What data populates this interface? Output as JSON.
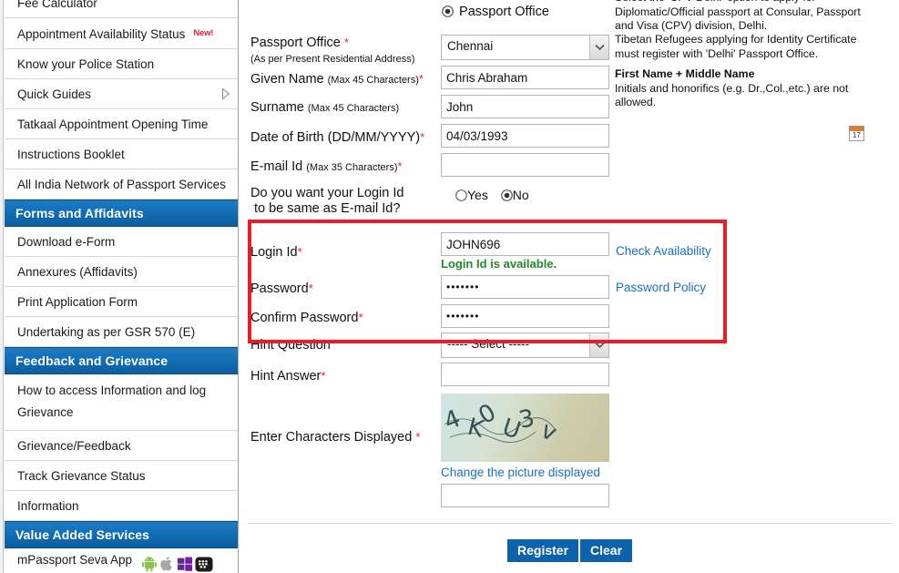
{
  "sidebar": {
    "items": [
      {
        "label": "Fee Calculator",
        "badge": null,
        "caret": false,
        "type": "item",
        "partial": true
      },
      {
        "label": "Appointment Availability Status",
        "badge": "New!",
        "caret": false,
        "type": "item"
      },
      {
        "label": "Know your Police Station",
        "badge": null,
        "caret": false,
        "type": "item"
      },
      {
        "label": "Quick Guides",
        "badge": null,
        "caret": true,
        "type": "item"
      },
      {
        "label": "Tatkaal Appointment Opening Time",
        "badge": null,
        "caret": false,
        "type": "item"
      },
      {
        "label": "Instructions Booklet",
        "badge": null,
        "caret": false,
        "type": "item"
      },
      {
        "label": "All India Network of Passport Services",
        "badge": null,
        "caret": false,
        "type": "item"
      },
      {
        "label": "Forms and Affidavits",
        "type": "header"
      },
      {
        "label": "Download e-Form",
        "badge": null,
        "caret": false,
        "type": "item"
      },
      {
        "label": "Annexures (Affidavits)",
        "badge": null,
        "caret": false,
        "type": "item"
      },
      {
        "label": "Print Application Form",
        "badge": null,
        "caret": false,
        "type": "item"
      },
      {
        "label": "Undertaking as per GSR 570 (E)",
        "badge": null,
        "caret": false,
        "type": "item"
      },
      {
        "label": "Feedback and Grievance",
        "type": "header"
      },
      {
        "label": "How to access Information and log Grievance",
        "badge": null,
        "caret": false,
        "type": "item",
        "twoline": true
      },
      {
        "label": "Grievance/Feedback",
        "badge": null,
        "caret": false,
        "type": "item"
      },
      {
        "label": "Track Grievance Status",
        "badge": null,
        "caret": false,
        "type": "item"
      },
      {
        "label": "Information",
        "badge": null,
        "caret": false,
        "type": "item"
      },
      {
        "label": "Value Added Services",
        "type": "header"
      },
      {
        "label": "mPassport Seva App",
        "type": "app-row",
        "icons": [
          "android-icon",
          "apple-icon",
          "windows-icon",
          "blackberry-icon"
        ]
      }
    ]
  },
  "form": {
    "office_radio": {
      "label": "Passport Office",
      "selected": true
    },
    "passport_office": {
      "label": "Passport Office",
      "sublabel": "(As per Present Residential Address)",
      "required": true,
      "value": "Chennai"
    },
    "given_name": {
      "label": "Given Name",
      "sublabel": "(Max 45 Characters)",
      "required": true,
      "value": "Chris Abraham"
    },
    "surname": {
      "label": "Surname",
      "sublabel": "(Max 45 Characters)",
      "required": false,
      "value": "John"
    },
    "dob": {
      "label": "Date of Birth (DD/MM/YYYY)",
      "required": true,
      "value": "04/03/1993",
      "calendar_day": "17"
    },
    "email": {
      "label": "E-mail Id",
      "sublabel": "(Max 35 Characters)",
      "required": true,
      "value": ""
    },
    "login_same_as_email": {
      "label_line1": "Do you want your Login Id",
      "label_line2": "to be same as E-mail Id?",
      "yes_label": "Yes",
      "no_label": "No",
      "selected": "No"
    },
    "login_id": {
      "label": "Login Id",
      "required": true,
      "value": "JOHN696",
      "link": "Check Availability",
      "availability_message": "Login Id is available."
    },
    "password": {
      "label": "Password",
      "required": true,
      "value": "•••••••",
      "link": "Password Policy"
    },
    "confirm_password": {
      "label": "Confirm Password",
      "required": true,
      "value": "•••••••"
    },
    "hint_question": {
      "label": "Hint Question",
      "required": false,
      "value": "----- Select -----"
    },
    "hint_answer": {
      "label": "Hint Answer",
      "required": true,
      "value": ""
    },
    "captcha": {
      "label": "Enter Characters Displayed",
      "required": true,
      "change_link": "Change the picture displayed",
      "value": ""
    },
    "buttons": {
      "register": "Register",
      "clear": "Clear"
    }
  },
  "helpers": {
    "cpv_delhi": "Select the 'CPV Delhi' option to apply for Diplomatic/Official passport at Consular, Passport and Visa (CPV) division, Delhi.",
    "tibetan": "Tibetan Refugees applying for Identity Certificate must register with 'Delhi' Passport Office.",
    "name_title": "First Name + Middle Name",
    "name_body": "Initials and honorifics (e.g. Dr.,Col.,etc.) are not allowed."
  },
  "colors": {
    "header_blue": "#0d5d9f",
    "link_blue": "#1a6fc4",
    "required_red": "#e8222a",
    "success_green": "#1d8b2a",
    "highlight_red": "#ec1c24",
    "button_blue": "#0d63ab"
  }
}
